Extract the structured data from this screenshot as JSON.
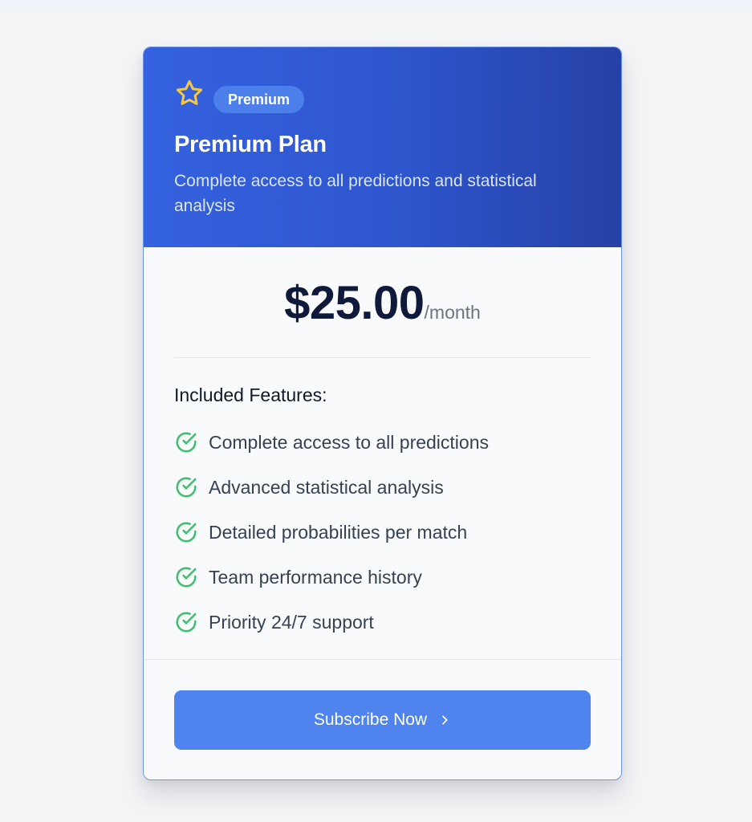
{
  "plan": {
    "badge": "Premium",
    "title": "Premium Plan",
    "description": "Complete access to all predictions and statistical analysis",
    "icon": "star-icon"
  },
  "price": {
    "amount": "$25.00",
    "period": "/month"
  },
  "features": {
    "title": "Included Features:",
    "icon": "check-circle-icon",
    "items": [
      "Complete access to all predictions",
      "Advanced statistical analysis",
      "Detailed probabilities per match",
      "Team performance history",
      "Priority 24/7 support"
    ]
  },
  "cta": {
    "label": "Subscribe Now",
    "icon": "chevron-right-icon"
  },
  "colors": {
    "header_gradient_start": "#3562e0",
    "header_gradient_end": "#2641a6",
    "accent": "#4f83ee",
    "star": "#f6c844",
    "check": "#3fbf6e",
    "price_text": "#0f1a3a"
  }
}
